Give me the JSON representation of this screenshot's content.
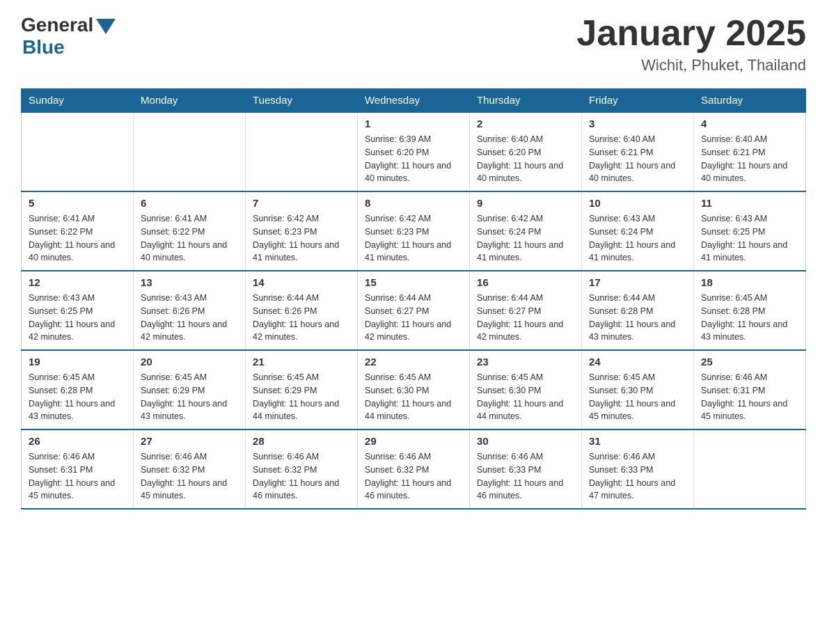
{
  "logo": {
    "general": "General",
    "blue": "Blue"
  },
  "header": {
    "month_title": "January 2025",
    "location": "Wichit, Phuket, Thailand"
  },
  "days_of_week": [
    "Sunday",
    "Monday",
    "Tuesday",
    "Wednesday",
    "Thursday",
    "Friday",
    "Saturday"
  ],
  "weeks": [
    [
      {
        "day": "",
        "sunrise": "",
        "sunset": "",
        "daylight": ""
      },
      {
        "day": "",
        "sunrise": "",
        "sunset": "",
        "daylight": ""
      },
      {
        "day": "",
        "sunrise": "",
        "sunset": "",
        "daylight": ""
      },
      {
        "day": "1",
        "sunrise": "Sunrise: 6:39 AM",
        "sunset": "Sunset: 6:20 PM",
        "daylight": "Daylight: 11 hours and 40 minutes."
      },
      {
        "day": "2",
        "sunrise": "Sunrise: 6:40 AM",
        "sunset": "Sunset: 6:20 PM",
        "daylight": "Daylight: 11 hours and 40 minutes."
      },
      {
        "day": "3",
        "sunrise": "Sunrise: 6:40 AM",
        "sunset": "Sunset: 6:21 PM",
        "daylight": "Daylight: 11 hours and 40 minutes."
      },
      {
        "day": "4",
        "sunrise": "Sunrise: 6:40 AM",
        "sunset": "Sunset: 6:21 PM",
        "daylight": "Daylight: 11 hours and 40 minutes."
      }
    ],
    [
      {
        "day": "5",
        "sunrise": "Sunrise: 6:41 AM",
        "sunset": "Sunset: 6:22 PM",
        "daylight": "Daylight: 11 hours and 40 minutes."
      },
      {
        "day": "6",
        "sunrise": "Sunrise: 6:41 AM",
        "sunset": "Sunset: 6:22 PM",
        "daylight": "Daylight: 11 hours and 40 minutes."
      },
      {
        "day": "7",
        "sunrise": "Sunrise: 6:42 AM",
        "sunset": "Sunset: 6:23 PM",
        "daylight": "Daylight: 11 hours and 41 minutes."
      },
      {
        "day": "8",
        "sunrise": "Sunrise: 6:42 AM",
        "sunset": "Sunset: 6:23 PM",
        "daylight": "Daylight: 11 hours and 41 minutes."
      },
      {
        "day": "9",
        "sunrise": "Sunrise: 6:42 AM",
        "sunset": "Sunset: 6:24 PM",
        "daylight": "Daylight: 11 hours and 41 minutes."
      },
      {
        "day": "10",
        "sunrise": "Sunrise: 6:43 AM",
        "sunset": "Sunset: 6:24 PM",
        "daylight": "Daylight: 11 hours and 41 minutes."
      },
      {
        "day": "11",
        "sunrise": "Sunrise: 6:43 AM",
        "sunset": "Sunset: 6:25 PM",
        "daylight": "Daylight: 11 hours and 41 minutes."
      }
    ],
    [
      {
        "day": "12",
        "sunrise": "Sunrise: 6:43 AM",
        "sunset": "Sunset: 6:25 PM",
        "daylight": "Daylight: 11 hours and 42 minutes."
      },
      {
        "day": "13",
        "sunrise": "Sunrise: 6:43 AM",
        "sunset": "Sunset: 6:26 PM",
        "daylight": "Daylight: 11 hours and 42 minutes."
      },
      {
        "day": "14",
        "sunrise": "Sunrise: 6:44 AM",
        "sunset": "Sunset: 6:26 PM",
        "daylight": "Daylight: 11 hours and 42 minutes."
      },
      {
        "day": "15",
        "sunrise": "Sunrise: 6:44 AM",
        "sunset": "Sunset: 6:27 PM",
        "daylight": "Daylight: 11 hours and 42 minutes."
      },
      {
        "day": "16",
        "sunrise": "Sunrise: 6:44 AM",
        "sunset": "Sunset: 6:27 PM",
        "daylight": "Daylight: 11 hours and 42 minutes."
      },
      {
        "day": "17",
        "sunrise": "Sunrise: 6:44 AM",
        "sunset": "Sunset: 6:28 PM",
        "daylight": "Daylight: 11 hours and 43 minutes."
      },
      {
        "day": "18",
        "sunrise": "Sunrise: 6:45 AM",
        "sunset": "Sunset: 6:28 PM",
        "daylight": "Daylight: 11 hours and 43 minutes."
      }
    ],
    [
      {
        "day": "19",
        "sunrise": "Sunrise: 6:45 AM",
        "sunset": "Sunset: 6:28 PM",
        "daylight": "Daylight: 11 hours and 43 minutes."
      },
      {
        "day": "20",
        "sunrise": "Sunrise: 6:45 AM",
        "sunset": "Sunset: 6:29 PM",
        "daylight": "Daylight: 11 hours and 43 minutes."
      },
      {
        "day": "21",
        "sunrise": "Sunrise: 6:45 AM",
        "sunset": "Sunset: 6:29 PM",
        "daylight": "Daylight: 11 hours and 44 minutes."
      },
      {
        "day": "22",
        "sunrise": "Sunrise: 6:45 AM",
        "sunset": "Sunset: 6:30 PM",
        "daylight": "Daylight: 11 hours and 44 minutes."
      },
      {
        "day": "23",
        "sunrise": "Sunrise: 6:45 AM",
        "sunset": "Sunset: 6:30 PM",
        "daylight": "Daylight: 11 hours and 44 minutes."
      },
      {
        "day": "24",
        "sunrise": "Sunrise: 6:45 AM",
        "sunset": "Sunset: 6:30 PM",
        "daylight": "Daylight: 11 hours and 45 minutes."
      },
      {
        "day": "25",
        "sunrise": "Sunrise: 6:46 AM",
        "sunset": "Sunset: 6:31 PM",
        "daylight": "Daylight: 11 hours and 45 minutes."
      }
    ],
    [
      {
        "day": "26",
        "sunrise": "Sunrise: 6:46 AM",
        "sunset": "Sunset: 6:31 PM",
        "daylight": "Daylight: 11 hours and 45 minutes."
      },
      {
        "day": "27",
        "sunrise": "Sunrise: 6:46 AM",
        "sunset": "Sunset: 6:32 PM",
        "daylight": "Daylight: 11 hours and 45 minutes."
      },
      {
        "day": "28",
        "sunrise": "Sunrise: 6:46 AM",
        "sunset": "Sunset: 6:32 PM",
        "daylight": "Daylight: 11 hours and 46 minutes."
      },
      {
        "day": "29",
        "sunrise": "Sunrise: 6:46 AM",
        "sunset": "Sunset: 6:32 PM",
        "daylight": "Daylight: 11 hours and 46 minutes."
      },
      {
        "day": "30",
        "sunrise": "Sunrise: 6:46 AM",
        "sunset": "Sunset: 6:33 PM",
        "daylight": "Daylight: 11 hours and 46 minutes."
      },
      {
        "day": "31",
        "sunrise": "Sunrise: 6:46 AM",
        "sunset": "Sunset: 6:33 PM",
        "daylight": "Daylight: 11 hours and 47 minutes."
      },
      {
        "day": "",
        "sunrise": "",
        "sunset": "",
        "daylight": ""
      }
    ]
  ]
}
